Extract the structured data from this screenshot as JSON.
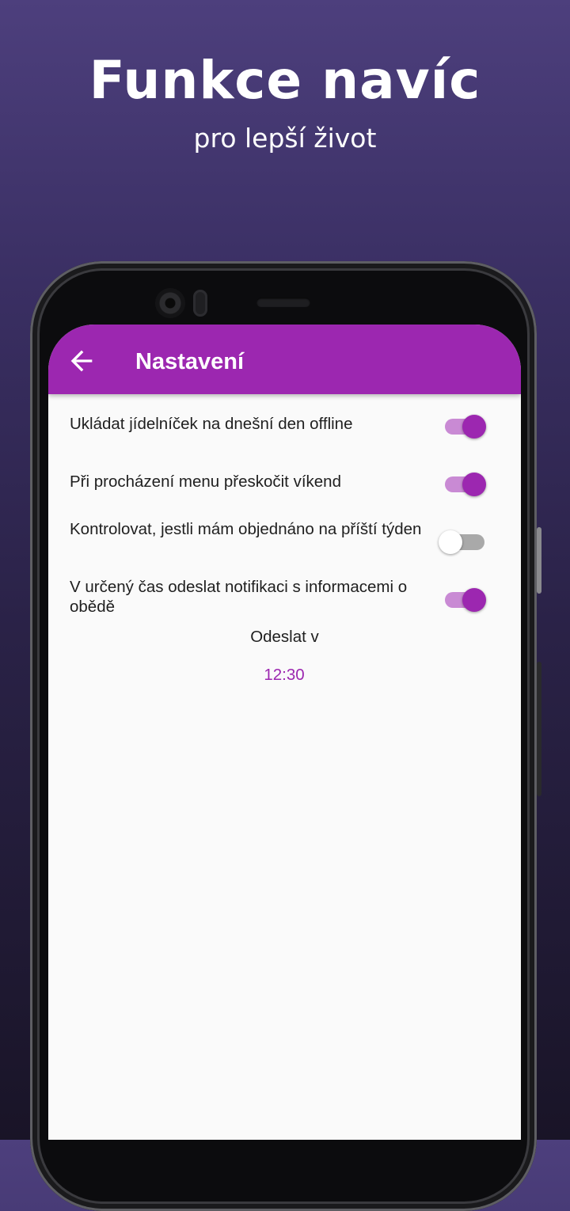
{
  "promo": {
    "title": "Funkce navíc",
    "subtitle": "pro lepší život"
  },
  "colors": {
    "primary": "#9c27b0",
    "switch_track_on": "#c98ad4",
    "switch_track_off": "#a9a9a9",
    "background_top": "#4d3f7d",
    "background_bottom": "#191427"
  },
  "appbar": {
    "back_icon": "arrow-left-icon",
    "title": "Nastavení"
  },
  "settings": [
    {
      "label": "Ukládat jídelníček na dnešní den offline",
      "enabled": true
    },
    {
      "label": "Při procházení menu přeskočit víkend",
      "enabled": true
    },
    {
      "label": "Kontrolovat, jestli mám objednáno na příští týden",
      "enabled": false
    },
    {
      "label": "V určený čas odeslat notifikaci s informacemi o obědě",
      "enabled": true
    }
  ],
  "notification": {
    "send_label": "Odeslat v",
    "time": "12:30"
  }
}
